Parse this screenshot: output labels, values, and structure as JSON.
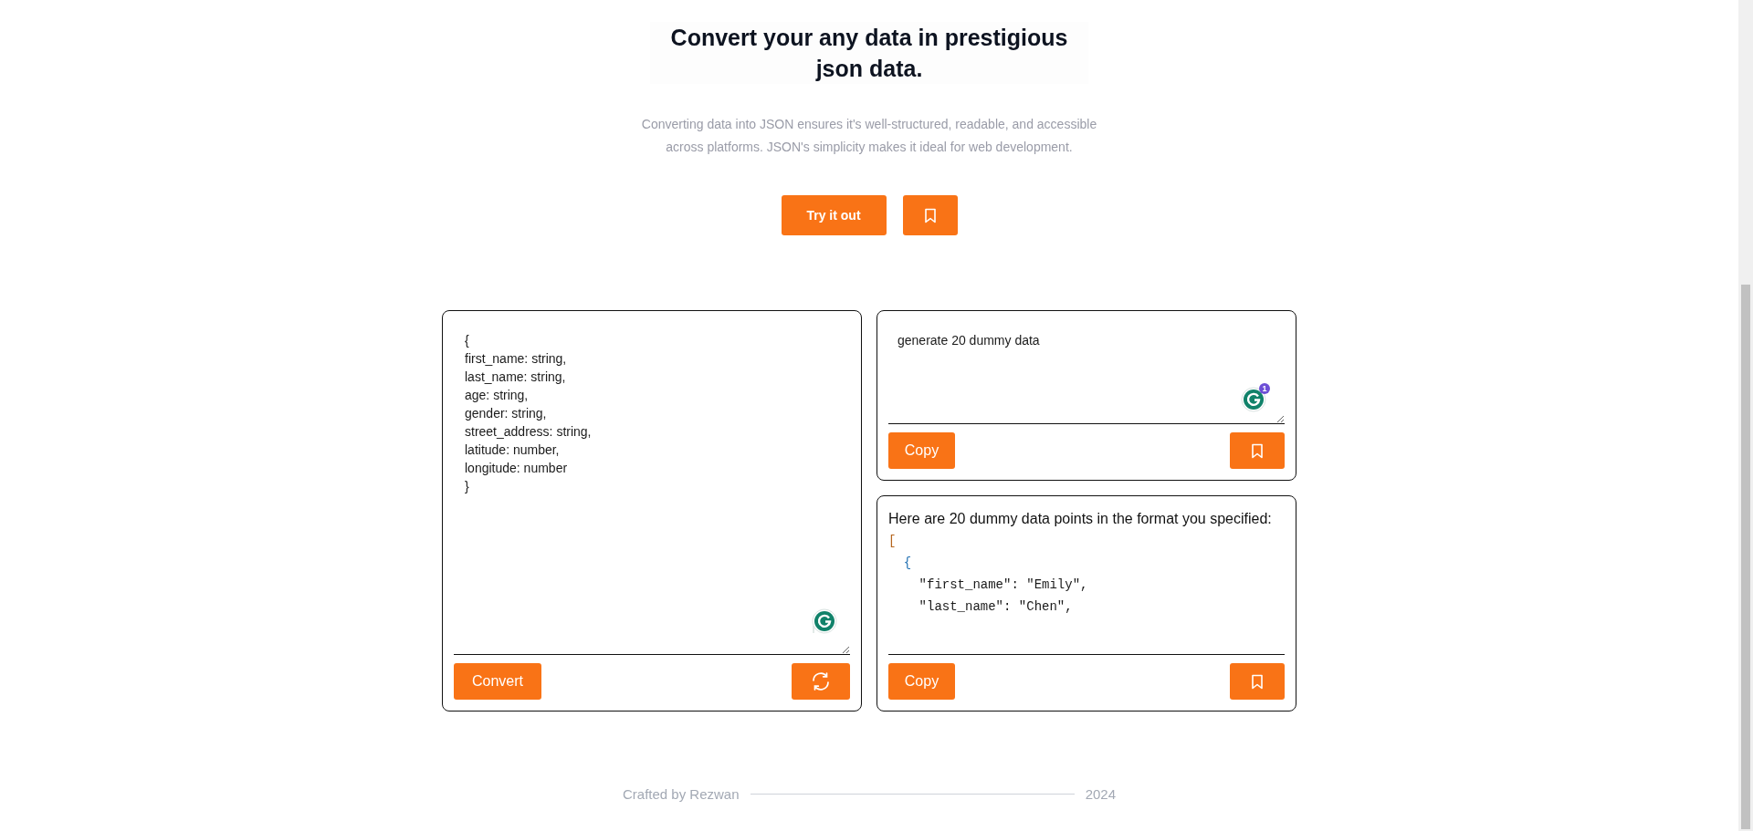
{
  "hero": {
    "title": "Convert your any data in prestigious json data.",
    "description": "Converting data into JSON ensures it's well-structured, readable, and accessible across platforms. JSON's simplicity makes it ideal for web development.",
    "primary_button": "Try it out"
  },
  "schema_panel": {
    "value": "{\nfirst_name: string,\nlast_name: string,\nage: string,\ngender: string,\nstreet_address: string,\nlatitude: number,\nlongitude: number\n}",
    "convert_button": "Convert"
  },
  "prompt_panel": {
    "value": "generate 20 dummy data",
    "grammar_badge": "1",
    "copy_button": "Copy"
  },
  "result_panel": {
    "intro": "Here are 20 dummy data points in the format you specified:",
    "code_lines": [
      {
        "kind": "bracket",
        "text": "["
      },
      {
        "kind": "brace",
        "text": "  {"
      },
      {
        "kind": "field",
        "text": "    \"first_name\": \"Emily\","
      },
      {
        "kind": "field",
        "text": "    \"last_name\": \"Chen\","
      }
    ],
    "copy_button": "Copy"
  },
  "footer": {
    "credit": "Crafted by Rezwan",
    "year": "2024"
  }
}
